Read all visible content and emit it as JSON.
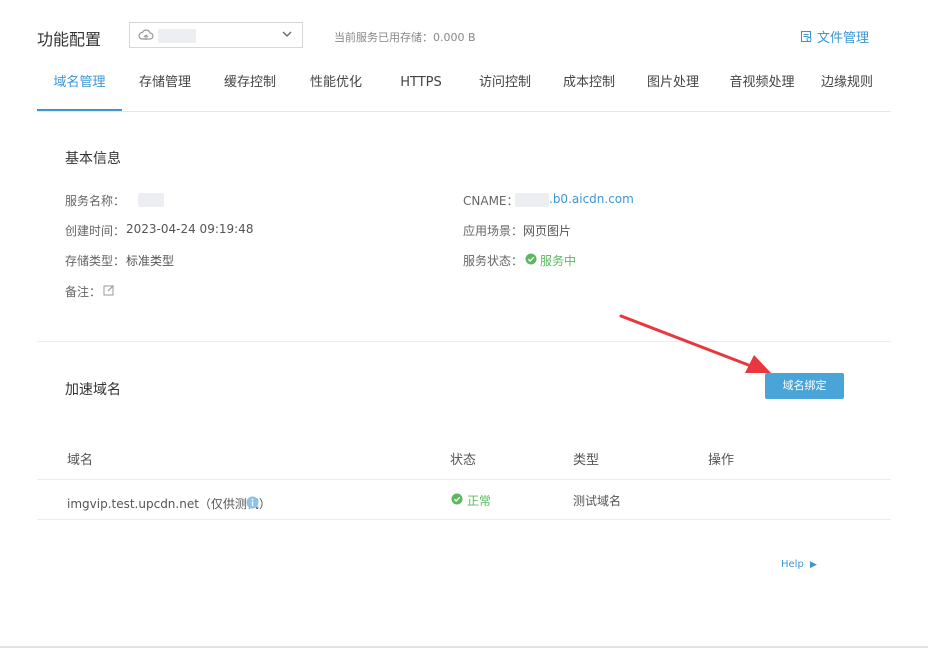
{
  "header": {
    "title": "功能配置",
    "service_select": {
      "selected": ""
    },
    "storage_label": "当前服务已用存储：",
    "storage_value": "0.000 B",
    "file_manage_label": "文件管理"
  },
  "tabs": [
    {
      "label": "域名管理",
      "active": true
    },
    {
      "label": "存储管理"
    },
    {
      "label": "缓存控制"
    },
    {
      "label": "性能优化"
    },
    {
      "label": "HTTPS"
    },
    {
      "label": "访问控制"
    },
    {
      "label": "成本控制"
    },
    {
      "label": "图片处理"
    },
    {
      "label": "音视频处理"
    },
    {
      "label": "边缘规则"
    }
  ],
  "basic_info": {
    "title": "基本信息",
    "service_name_label": "服务名称：",
    "created_label": "创建时间：",
    "created_value": "2023-04-24 09:19:48",
    "storage_type_label": "存储类型：",
    "storage_type_value": "标准类型",
    "remark_label": "备注：",
    "cname_label": "CNAME：",
    "cname_suffix": ".b0.aicdn.com",
    "scene_label": "应用场景：",
    "scene_value": "网页图片",
    "status_label": "服务状态：",
    "status_value": "服务中"
  },
  "domains": {
    "title": "加速域名",
    "bind_button": "域名绑定",
    "columns": [
      "域名",
      "状态",
      "类型",
      "操作"
    ],
    "rows": [
      {
        "domain": "imgvip.test.upcdn.net（仅供测试）",
        "status": "正常",
        "type": "测试域名",
        "action": ""
      }
    ]
  },
  "help_label": "Help",
  "colors": {
    "accent": "#3c96d4",
    "success": "#5cb85c",
    "arrow": "#e8383d"
  }
}
